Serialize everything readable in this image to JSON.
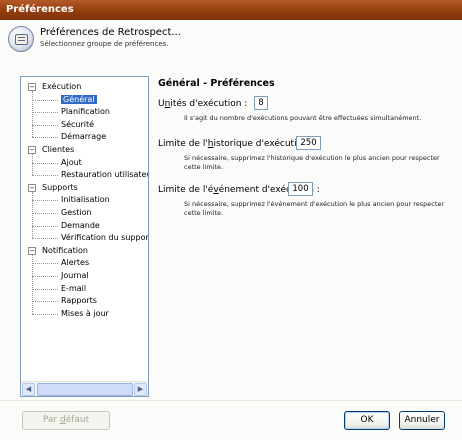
{
  "window": {
    "title": "Préférences"
  },
  "header": {
    "icon": "preferences-scroll-icon",
    "title": "Préférences de Retrospect...",
    "subtitle": "Sélectionnez groupe de préférences."
  },
  "tree": [
    {
      "label": "Exécution",
      "level": 0,
      "toggle": "−"
    },
    {
      "label": "Général",
      "level": 1,
      "selected": true
    },
    {
      "label": "Planification",
      "level": 1
    },
    {
      "label": "Sécurité",
      "level": 1
    },
    {
      "label": "Démarrage",
      "level": 1
    },
    {
      "label": "Clientes",
      "level": 0,
      "toggle": "−"
    },
    {
      "label": "Ajout",
      "level": 1
    },
    {
      "label": "Restauration utilisateur",
      "level": 1
    },
    {
      "label": "Supports",
      "level": 0,
      "toggle": "−"
    },
    {
      "label": "Initialisation",
      "level": 1
    },
    {
      "label": "Gestion",
      "level": 1
    },
    {
      "label": "Demande",
      "level": 1
    },
    {
      "label": "Vérification du support",
      "level": 1
    },
    {
      "label": "Notification",
      "level": 0,
      "toggle": "−"
    },
    {
      "label": "Alertes",
      "level": 1
    },
    {
      "label": "Journal",
      "level": 1
    },
    {
      "label": "E-mail",
      "level": 1
    },
    {
      "label": "Rapports",
      "level": 1
    },
    {
      "label": "Mises à jour",
      "level": 1
    }
  ],
  "main": {
    "title": "Général - Préférences",
    "units_label_pre": "U",
    "units_label_ul": "n",
    "units_label_post": "ités d'exécution :",
    "units_value": "8",
    "units_help": "Il s'agit du nombre d'exécutions pouvant être effectuées simultanément.",
    "history_label_pre": "Limite de l'",
    "history_label_ul": "h",
    "history_label_post": "istorique d'exécution :",
    "history_value": "250",
    "history_help": "Si nécessaire, supprimez l'historique d'exécution le plus ancien pour respecter cette limite.",
    "events_label_pre": "Limite de l'é",
    "events_label_ul": "v",
    "events_label_post": "énement d'exécution :",
    "events_value": "100",
    "events_help": "Si nécessaire, supprimez l'événement d'exécution le plus ancien pour respecter cette limite."
  },
  "footer": {
    "default_pre": "Par ",
    "default_ul": "d",
    "default_post": "éfaut",
    "ok_label": "OK",
    "cancel_label": "Annuler"
  },
  "colors": {
    "titlebar": "#96400f",
    "selection": "#316ac5"
  }
}
